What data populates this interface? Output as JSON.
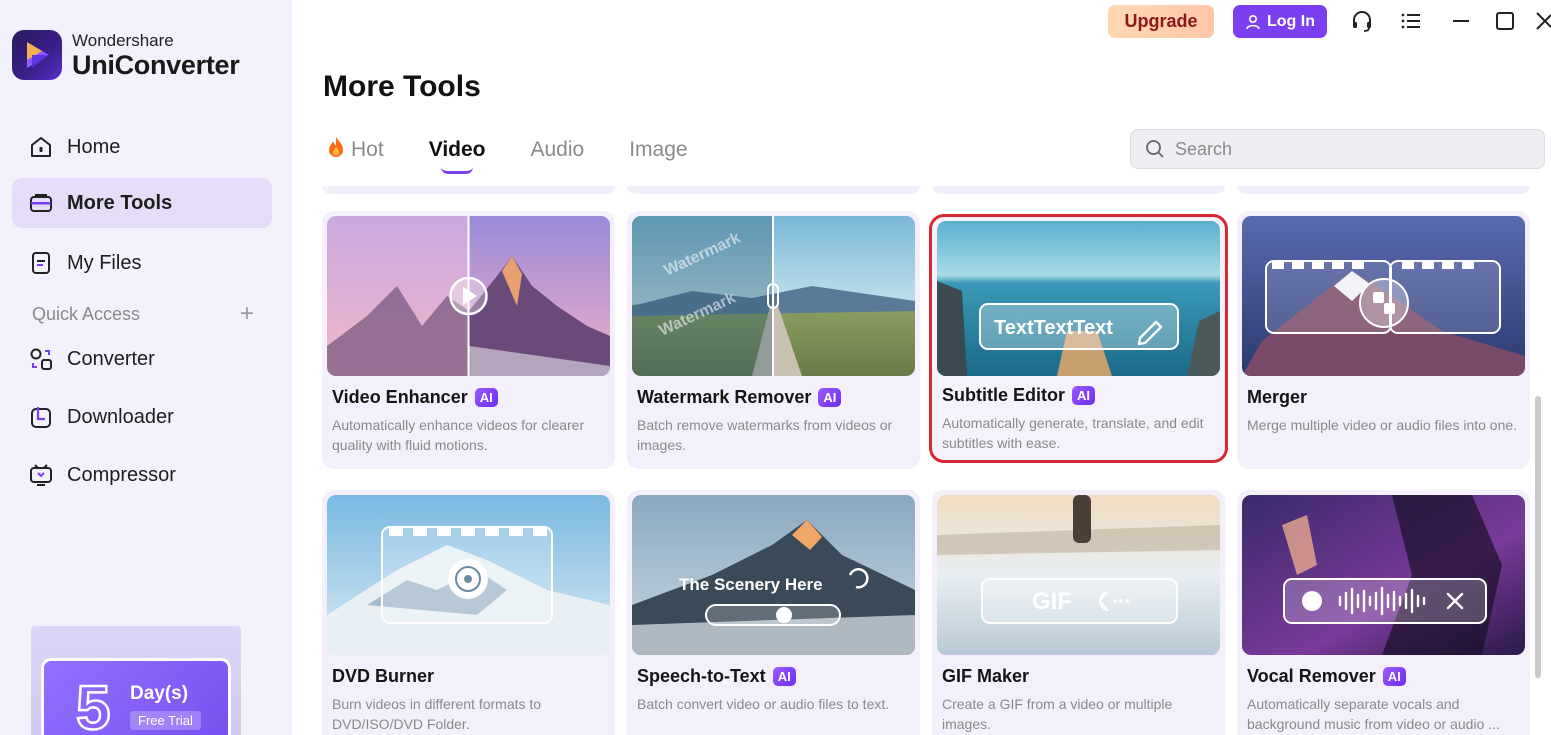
{
  "brand": {
    "subtitle": "Wondershare",
    "name": "UniConverter"
  },
  "sidebar": {
    "items": [
      {
        "label": "Home",
        "icon": "home-icon"
      },
      {
        "label": "More Tools",
        "icon": "toolbox-icon",
        "active": true
      },
      {
        "label": "My Files",
        "icon": "file-icon"
      },
      {
        "label": "Converter",
        "icon": "converter-icon"
      },
      {
        "label": "Downloader",
        "icon": "downloader-icon"
      },
      {
        "label": "Compressor",
        "icon": "compressor-icon"
      }
    ],
    "quick_access": "Quick Access",
    "quick_add": "+",
    "trial": {
      "number": "5",
      "days": "Day(s)",
      "label": "Free Trial"
    }
  },
  "topbar": {
    "upgrade": "Upgrade",
    "login": "Log In"
  },
  "main": {
    "title": "More Tools",
    "tabs": [
      {
        "label": "Hot",
        "active": false
      },
      {
        "label": "Video",
        "active": true
      },
      {
        "label": "Audio",
        "active": false
      },
      {
        "label": "Image",
        "active": false
      }
    ],
    "search_placeholder": "Search"
  },
  "cards": [
    {
      "title": "Video Enhancer",
      "ai": "AI",
      "desc": "Automatically enhance videos for clearer quality with fluid motions."
    },
    {
      "title": "Watermark Remover",
      "ai": "AI",
      "desc": "Batch remove watermarks from videos or images.",
      "thumb_text": "Watermark"
    },
    {
      "title": "Subtitle Editor",
      "ai": "AI",
      "desc": "Automatically generate, translate, and edit subtitles with ease.",
      "thumb_text": "TextTextText",
      "selected": true
    },
    {
      "title": "Merger",
      "ai": "",
      "desc": "Merge multiple video or audio files into one."
    },
    {
      "title": "DVD Burner",
      "ai": "",
      "desc": "Burn videos in different formats to DVD/ISO/DVD Folder."
    },
    {
      "title": "Speech-to-Text",
      "ai": "AI",
      "desc": "Batch convert video or audio files to text.",
      "thumb_text": "The Scenery Here"
    },
    {
      "title": "GIF Maker",
      "ai": "",
      "desc": "Create a GIF from a video or multiple images.",
      "thumb_text": "GIF"
    },
    {
      "title": "Vocal Remover",
      "ai": "AI",
      "desc": "Automatically separate vocals and background music from video or audio ..."
    }
  ],
  "colors": {
    "accent": "#7b3ff2",
    "selection": "#d62832",
    "card_bg": "#f3f0fb",
    "sidebar_bg": "#f3f1fb"
  }
}
